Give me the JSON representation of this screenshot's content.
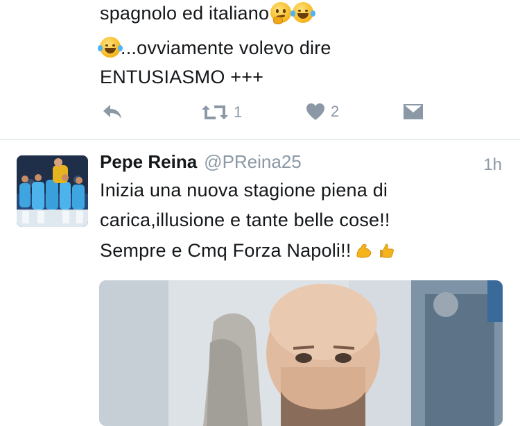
{
  "previous_tweet": {
    "line1": "spagnolo ed italiano",
    "line2": "...ovviamente volevo dire",
    "line3": "ENTUSIASMO +++",
    "actions": {
      "retweet_count": "1",
      "like_count": "2"
    }
  },
  "tweet": {
    "author_name": "Pepe Reina",
    "handle": "@PReina25",
    "time": "1h",
    "text_line1": "Inizia una nuova stagione piena di",
    "text_line2": "carica,illusione e tante belle cose!!",
    "text_line3": "Sempre e Cmq Forza Napoli!!"
  },
  "colors": {
    "text": "#14171a",
    "secondary": "#8b98a5",
    "divider": "#e6ecf0"
  },
  "icons": [
    "thinking-face-emoji",
    "tears-of-joy-emoji",
    "reply-icon",
    "retweet-icon",
    "heart-icon",
    "direct-message-icon",
    "flexed-biceps-emoji",
    "thumbs-up-emoji"
  ]
}
